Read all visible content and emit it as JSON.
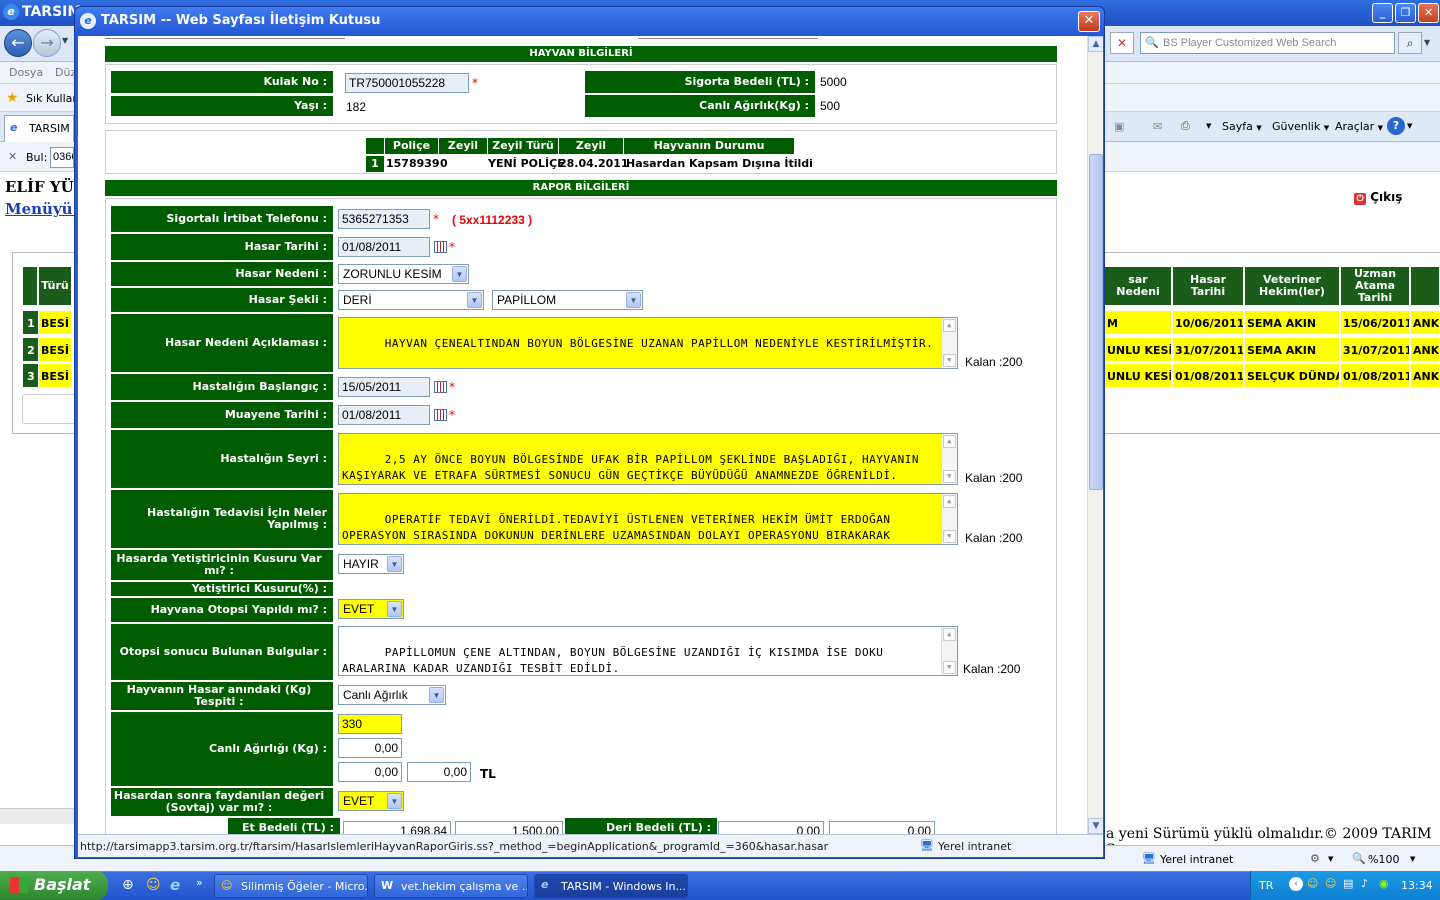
{
  "bg_window": {
    "title": "TARSIM",
    "search_placeholder": "BS Player Customized Web Search",
    "menu": {
      "file": "Dosya",
      "edit": "Düz"
    },
    "favorites": "Sık Kullanı",
    "tab": "TARSIM",
    "find_label": "Bul:",
    "find_value": "0366",
    "toolbar": {
      "page": "Sayfa",
      "security": "Güvenlik",
      "tools": "Araçlar"
    },
    "user_name": "ELİF YÜC",
    "menu_link": "Menüyü G",
    "logout": "Çıkış",
    "table": {
      "left_headers": [
        "Türü"
      ],
      "right_headers": [
        "sar Nedeni",
        "Hasar Tarihi",
        "Veteriner Hekim(ler)",
        "Uzman Atama Tarihi"
      ],
      "rows": [
        {
          "no": "1",
          "type": "BESİ",
          "reason": "M",
          "date": "10/06/2011",
          "vet": "SEMA AKIN",
          "assign": "15/06/2011",
          "city": "ANKA"
        },
        {
          "no": "2",
          "type": "BESİ",
          "reason": "UNLU KESİM",
          "date": "31/07/2011",
          "vet": "SEMA AKIN",
          "assign": "31/07/2011",
          "city": "ANKA"
        },
        {
          "no": "3",
          "type": "BESİ",
          "reason": "UNLU KESİM",
          "date": "01/08/2011",
          "vet": "SELÇUK DÜNDAR",
          "assign": "01/08/2011",
          "city": "ANKA"
        }
      ]
    },
    "footer_text": "a yeni Sürümü yüklü olmalıdır.© 2009 TARIM S",
    "status_zone": "Yerel intranet",
    "zoom": "%100"
  },
  "taskbar": {
    "start": "Başlat",
    "tasks": [
      "Silinmiş Öğeler - Micro...",
      "vet.hekim çalışma ve ...",
      "TARSIM - Windows In..."
    ],
    "lang": "TR",
    "clock": "13:34"
  },
  "dialog": {
    "title": "TARSIM -- Web Sayfası İletişim Kutusu",
    "sections": {
      "animal": "HAYVAN BİLGİLERİ",
      "report": "RAPOR BİLGİLERİ"
    },
    "animal": {
      "ear_label": "Kulak No :",
      "ear_value": "TR750001055228",
      "age_label": "Yaşı :",
      "age_value": "182",
      "sum_label": "Sigorta Bedeli (TL) :",
      "sum_value": "5000",
      "weight_label": "Canlı Ağırlık(Kg) :",
      "weight_value": "500"
    },
    "policy": {
      "headers": [
        "Poliçe No",
        "Zeyil No",
        "Zeyil Türü",
        "Zeyil Tarihi",
        "Hayvanın Durumu"
      ],
      "row": {
        "index": "1",
        "policy_no": "1578939",
        "addendum_no": "0",
        "addendum_type": "YENİ POLİÇE",
        "addendum_date": "28.04.2011",
        "status": "Hasardan Kapsam Dışına İtildi"
      }
    },
    "form": {
      "phone_label": "Sigortalı İrtibat Telefonu :",
      "phone_value": "5365271353",
      "phone_hint": "( 5xx1112233 )",
      "loss_date_label": "Hasar Tarihi :",
      "loss_date_value": "01/08/2011",
      "loss_reason_label": "Hasar Nedeni :",
      "loss_reason_value": "ZORUNLU KESİM",
      "loss_shape_label": "Hasar Şekli :",
      "loss_shape_value1": "DERİ",
      "loss_shape_value2": "PAPİLLOM",
      "reason_desc_label": "Hasar Nedeni Açıklaması :",
      "reason_desc_value": "HAYVAN ÇENEALTINDAN BOYUN BÖLGESİNE UZANAN PAPİLLOM NEDENİYLE KESTİRİLMİŞTİR.",
      "kalan": "Kalan :200",
      "disease_start_label": "Hastalığın Başlangıç :",
      "disease_start_value": "15/05/2011",
      "exam_date_label": "Muayene Tarihi :",
      "exam_date_value": "01/08/2011",
      "course_label": "Hastalığın Seyri :",
      "course_value": "2,5 AY ÖNCE BOYUN BÖLGESİNDE UFAK BİR PAPİLLOM ŞEKLİNDE BAŞLADIĞI, HAYVANIN KAŞIYARAK VE ETRAFA SÜRTMESİ SONUCU GÜN GEÇTİKÇE BÜYÜDÜĞÜ ANAMNEZDE ÖĞRENİLDİ.",
      "treatment_label": "Hastalığın Tedavisi İçin Neler Yapılmış :",
      "treatment_value": "OPERATİF TEDAVİ ÖNERİLDİ.TEDAVİYİ ÜSTLENEN VETERİNER HEKİM ÜMİT ERDOĞAN OPERASYON SIRASINDA DOKUNUN DERİNLERE UZAMASINDAN DOLAYI OPERASYONU BIRAKARAK KESİMİ ÖNERMİŞTİR.",
      "fault_label": "Hasarda Yetiştiricinin Kusuru Var mı? :",
      "fault_value": "HAYIR",
      "fault_pct_label": "Yetiştirici Kusuru(%) :",
      "autopsy_label": "Hayvana Otopsi Yapıldı mı? :",
      "autopsy_value": "EVET",
      "autopsy_result_label": "Otopsi sonucu Bulunan Bulgular :",
      "autopsy_result_value": "PAPİLLOMUN ÇENE ALTINDAN, BOYUN BÖLGESİNE UZANDIĞI İÇ KISIMDA İSE DOKU ARALARINA KADAR UZANDIĞI TESBİT EDİLDİ.",
      "weight_at_loss_label": "Hayvanın Hasar anındaki (Kg) Tespiti :",
      "weight_at_loss_value": "Canlı Ağırlık",
      "live_weight_label": "Canlı Ağırlığı (Kg) :",
      "live_weight_value": "330",
      "amount1": "0,00",
      "amount2": "0,00",
      "amount3": "0,00",
      "currency": "TL",
      "salvage_label": "Hasardan sonra faydanılan değeri (Sovtaj) var mı? :",
      "salvage_value": "EVET",
      "meat_label": "Et Bedeli (TL) :",
      "meat_value1": "1.698,84",
      "meat_value2": "1.500,00",
      "hide_label": "Deri Bedeli (TL) :",
      "hide_value1": "0,00",
      "hide_value2": "0,00"
    },
    "status_url": "http://tarsimapp3.tarsim.org.tr/ftarsim/HasarIslemleriHayvanRaporGiris.ss?_method_=beginApplication&_programId_=360&hasar.hasar",
    "status_zone": "Yerel intranet"
  }
}
